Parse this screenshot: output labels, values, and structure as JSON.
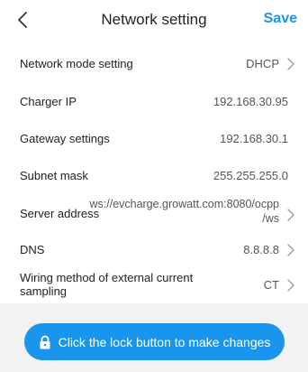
{
  "colors": {
    "accent": "#1a95ee"
  },
  "header": {
    "title": "Network setting",
    "save_label": "Save"
  },
  "settings": [
    {
      "label": "Network mode setting",
      "value": "DHCP",
      "chevron": true
    },
    {
      "label": "Charger IP",
      "value": "192.168.30.95",
      "chevron": false
    },
    {
      "label": "Gateway settings",
      "value": "192.168.30.1",
      "chevron": false
    },
    {
      "label": "Subnet mask",
      "value": "255.255.255.0",
      "chevron": false
    },
    {
      "label": "Server address",
      "value_line1": "ws://evcharge.growatt.com:8080/ocpp",
      "value_line2": "/ws",
      "chevron": true
    },
    {
      "label": "DNS",
      "value": "8.8.8.8",
      "chevron": true
    },
    {
      "label_line1": "Wiring method of external current",
      "label_line2": "sampling",
      "value": "CT",
      "chevron": true
    }
  ],
  "footer": {
    "lock_button_label": "Click the lock button to make changes",
    "lock_icon": "lock-icon"
  }
}
